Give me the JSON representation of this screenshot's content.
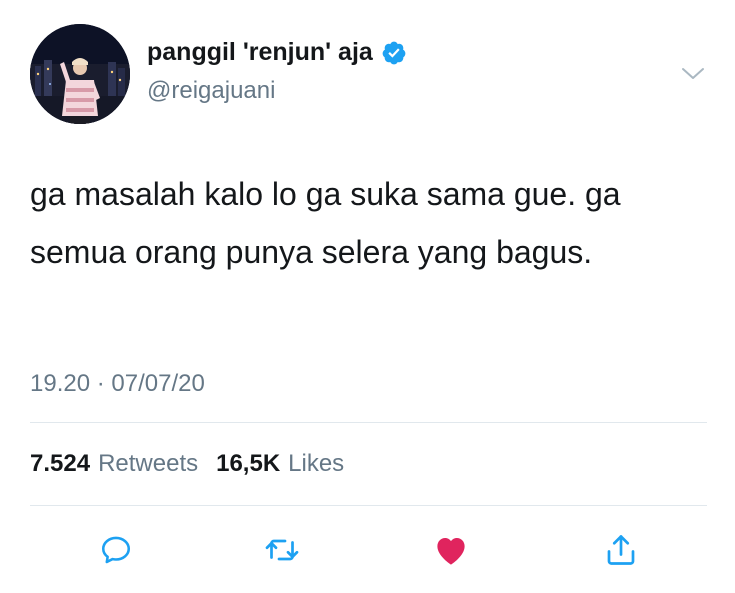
{
  "tweet": {
    "display_name": "panggil 'renjun' aja",
    "handle": "@reigajuani",
    "verified": true,
    "text": "ga masalah kalo lo ga suka sama gue. ga semua orang punya selera yang bagus.",
    "timestamp": "19.20 · 07/07/20"
  },
  "stats": {
    "retweets_count": "7.524",
    "retweets_label": "Retweets",
    "likes_count": "16,5K",
    "likes_label": "Likes"
  },
  "actions": {
    "reply_icon": "reply-icon",
    "retweet_icon": "retweet-icon",
    "like_icon": "heart-icon",
    "share_icon": "share-icon"
  },
  "colors": {
    "verified": "#1da1f2",
    "like_active": "#e0245e",
    "icon": "#1da1f2",
    "secondary_text": "#657786"
  }
}
